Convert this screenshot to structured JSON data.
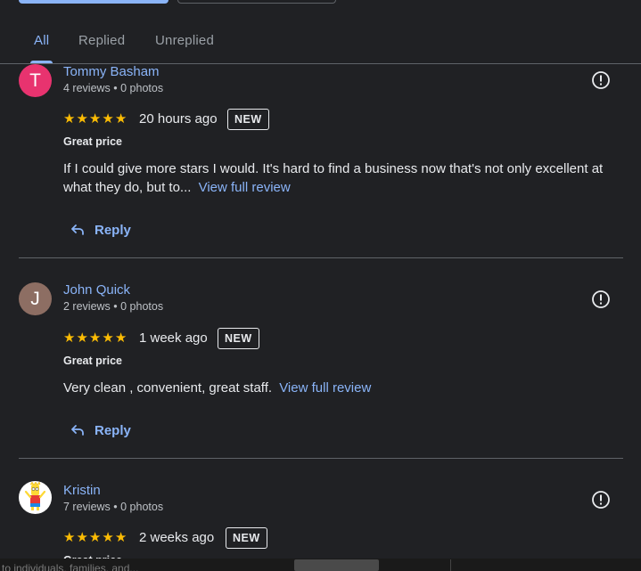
{
  "tabs": [
    {
      "label": "All",
      "active": true
    },
    {
      "label": "Replied",
      "active": false
    },
    {
      "label": "Unreplied",
      "active": false
    }
  ],
  "reviews": [
    {
      "avatar_letter": "T",
      "avatar_color": "#e8336f",
      "name": "Tommy Basham",
      "meta": "4 reviews • 0 photos",
      "rating": 5,
      "time": "20 hours ago",
      "badge": "NEW",
      "highlight": "Great price",
      "text": "If I could give more stars I would. It's hard to find a business now that's not only excellent at what they do, but to...",
      "view_full": "View full review",
      "reply_label": "Reply"
    },
    {
      "avatar_letter": "J",
      "avatar_color": "#8d6e63",
      "name": "John Quick",
      "meta": "2 reviews • 0 photos",
      "rating": 5,
      "time": "1 week ago",
      "badge": "NEW",
      "highlight": "Great price",
      "text": "Very clean , convenient, great staff.",
      "view_full": "View full review",
      "reply_label": "Reply"
    },
    {
      "avatar_icon": "cartoon-character-avatar",
      "name": "Kristin",
      "meta": "7 reviews • 0 photos",
      "rating": 5,
      "time": "2 weeks ago",
      "badge": "NEW",
      "highlight": "Great price"
    }
  ],
  "bottom_bar": {
    "text": "to individuals, families, and..."
  },
  "colors": {
    "background": "#202124",
    "accent": "#8ab4f8",
    "star": "#fbbc04",
    "divider": "#5f6368"
  }
}
